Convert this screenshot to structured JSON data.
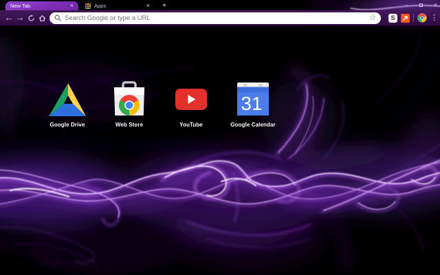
{
  "browser": {
    "tabs": [
      {
        "title": "New Tab",
        "active": true
      },
      {
        "title": "Apps",
        "active": false
      }
    ],
    "new_tab_button_glyph": "+",
    "tab_close_glyph": "×",
    "window_controls": {
      "minimize_glyph": "–",
      "close_glyph": "×"
    },
    "toolbar": {
      "back_glyph": "←",
      "forward_glyph": "→",
      "omnibox": {
        "placeholder": "Search Google or type a URL",
        "value": ""
      },
      "bookmark_star_glyph": "☆",
      "extensions": [
        {
          "letter": "S"
        },
        {
          "name": "orange-arrow-extension"
        }
      ],
      "menu_glyph": "⋮"
    }
  },
  "new_tab_page": {
    "shortcuts": [
      {
        "label": "Google Drive"
      },
      {
        "label": "Web Store"
      },
      {
        "label": "YouTube"
      },
      {
        "label": "Google Calendar",
        "date": "31"
      }
    ]
  },
  "theme": {
    "name": "purple smoke",
    "frame_color": "#0d0414",
    "toolbar_color": "#3a1150",
    "active_tab_color": "#8a35c8",
    "accent": "#a34fe0",
    "background": "#000000"
  }
}
